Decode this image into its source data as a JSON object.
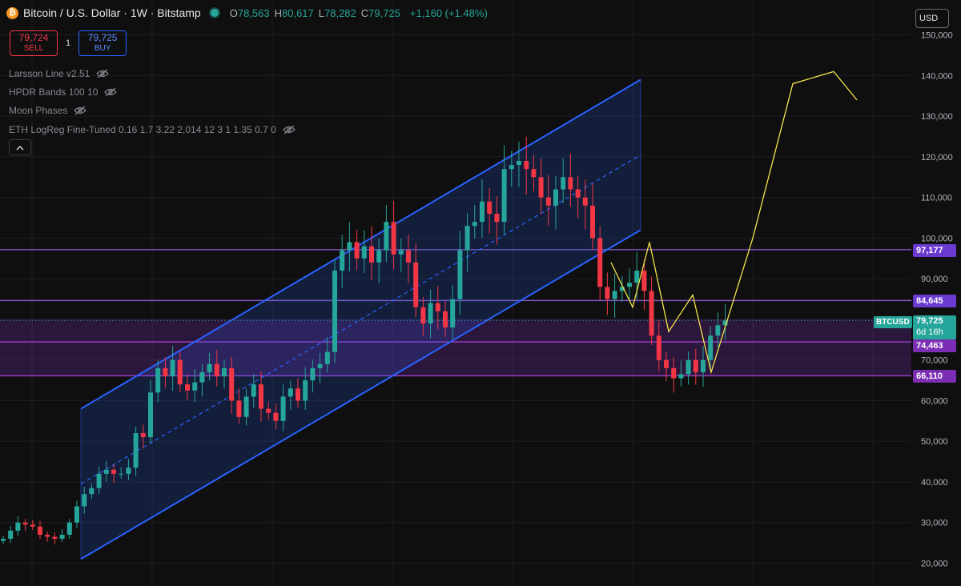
{
  "header": {
    "coin_glyph": "₿",
    "symbol_title": "Bitcoin / U.S. Dollar · 1W · Bitstamp",
    "open_label": "O",
    "open": "78,563",
    "high_label": "H",
    "high": "80,617",
    "low_label": "L",
    "low": "78,282",
    "close_label": "C",
    "close": "79,725",
    "change": "+1,160 (+1.48%)"
  },
  "trade": {
    "sell_price": "79,724",
    "sell_label": "SELL",
    "quantity": "1",
    "buy_price": "79,725",
    "buy_label": "BUY"
  },
  "indicators": [
    "Larsson Line v2.51",
    "HPDR Bands 100 10",
    "Moon Phases",
    "ETH LogReg Fine-Tuned 0.16 1.7 3.22 2,014 12 3 1 1.35 0.7 0"
  ],
  "collapse_icon": "chevron-up-icon",
  "currency_button": "USD",
  "price_axis": {
    "ticks": [
      "20,000",
      "30,000",
      "40,000",
      "50,000",
      "60,000",
      "70,000",
      "90,000",
      "100,000",
      "110,000",
      "120,000",
      "130,000",
      "140,000",
      "150,000"
    ]
  },
  "level_tags": [
    {
      "label": "97,177",
      "value": 97177
    },
    {
      "label": "84,645",
      "value": 84645
    },
    {
      "label": "74,463",
      "value": 74463
    },
    {
      "label": "66,110",
      "value": 66110
    }
  ],
  "current_price": {
    "symbol": "BTCUSD",
    "price": "79,725",
    "countdown": "6d 16h",
    "value": 79725
  },
  "colors": {
    "background": "#0f0f0f",
    "up": "#26a69a",
    "down": "#f23645",
    "channel": "#2962ff",
    "level": "#7e57c2",
    "projection": "#f5e34b"
  },
  "chart_data": {
    "type": "candlestick",
    "timeframe": "1W",
    "y_axis": {
      "min": 20000,
      "max": 150000,
      "scale": "linear",
      "position": "right"
    },
    "grid": true,
    "candles_weekly_close_approx": [
      26000,
      28000,
      30000,
      29500,
      29000,
      27000,
      26500,
      26000,
      27000,
      30000,
      34000,
      37000,
      38500,
      42000,
      43000,
      42000,
      42000,
      43500,
      52000,
      51000,
      62000,
      68000,
      66000,
      70000,
      64000,
      62500,
      64500,
      67000,
      69000,
      66000,
      68000,
      60000,
      56000,
      61000,
      64000,
      58000,
      57000,
      55000,
      61000,
      63000,
      60000,
      65000,
      68000,
      69000,
      72000,
      92000,
      97000,
      99000,
      95000,
      98000,
      94000,
      97000,
      104000,
      96000,
      97000,
      94000,
      83000,
      79000,
      84000,
      82000,
      78000,
      85000,
      97000,
      103000,
      104000,
      109000,
      106000,
      104000,
      117000,
      118000,
      119000,
      117000,
      115000,
      110000,
      108000,
      112000,
      115000,
      112000,
      110000,
      108000,
      100000,
      88000,
      85000,
      87000,
      88000,
      89000,
      92000,
      87000,
      76000,
      70000,
      68000,
      65500,
      66500,
      70000,
      67000,
      70000,
      76000,
      78563,
      79725
    ],
    "channel": {
      "upper_start": 58000,
      "upper_end": 139000,
      "mid_start": 39500,
      "mid_end": 120500,
      "lower_start": 21000,
      "lower_end": 102000
    },
    "horizontal_levels": [
      97177,
      84645,
      74463,
      66110
    ],
    "zone": {
      "from": 66110,
      "to": 80000
    },
    "projection_path": [
      94000,
      83000,
      99000,
      77000,
      86000,
      67000,
      100000,
      138000,
      141000,
      134000
    ]
  }
}
